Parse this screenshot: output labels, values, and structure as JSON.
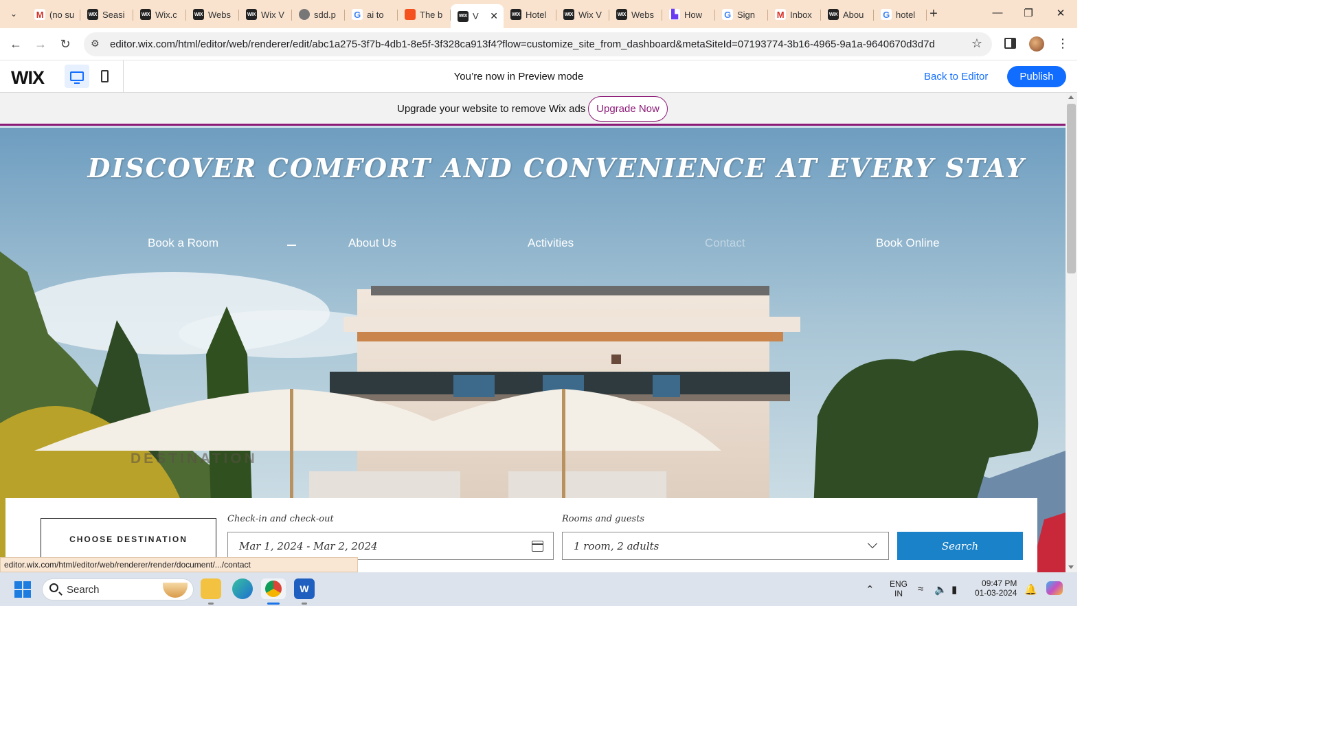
{
  "browser": {
    "tabs": [
      {
        "title": "(no su",
        "icon": "gmail-icon",
        "active": false
      },
      {
        "title": "Seasi",
        "icon": "wix-icon",
        "active": false
      },
      {
        "title": "Wix.c",
        "icon": "wix-icon",
        "active": false
      },
      {
        "title": "Webs",
        "icon": "wix-icon",
        "active": false
      },
      {
        "title": "Wix V",
        "icon": "wix-icon",
        "active": false
      },
      {
        "title": "sdd.p",
        "icon": "globe-icon",
        "active": false
      },
      {
        "title": "ai to",
        "icon": "google-icon",
        "active": false
      },
      {
        "title": "The b",
        "icon": "orange-square-icon",
        "active": false
      },
      {
        "title": "V",
        "icon": "wix-icon",
        "active": true
      },
      {
        "title": "Hotel",
        "icon": "wix-icon",
        "active": false
      },
      {
        "title": "Wix V",
        "icon": "wix-icon",
        "active": false
      },
      {
        "title": "Webs",
        "icon": "wix-icon",
        "active": false
      },
      {
        "title": "How",
        "icon": "purple-logo-icon",
        "active": false
      },
      {
        "title": "Sign",
        "icon": "google-icon",
        "active": false
      },
      {
        "title": "Inbox",
        "icon": "gmail-icon",
        "active": false
      },
      {
        "title": "Abou",
        "icon": "wix-icon",
        "active": false
      },
      {
        "title": "hotel",
        "icon": "google-icon",
        "active": false
      }
    ],
    "url": "editor.wix.com/html/editor/web/renderer/edit/abc1a275-3f7b-4db1-8e5f-3f328ca913f4?flow=customize_site_from_dashboard&metaSiteId=07193774-3b16-4965-9a1a-9640670d3d7d",
    "status_url": "editor.wix.com/html/editor/web/renderer/render/document/.../contact"
  },
  "wix_bar": {
    "logo": "WIX",
    "preview_message": "You’re now in Preview mode",
    "back_to_editor": "Back to Editor",
    "publish": "Publish"
  },
  "ad_banner": {
    "text": "Upgrade your website to remove Wix ads",
    "button": "Upgrade Now"
  },
  "hero": {
    "title": "DISCOVER COMFORT AND CONVENIENCE AT EVERY STAY",
    "nav": [
      "Book a Room",
      "About Us",
      "Activities",
      "Contact",
      "Book Online"
    ],
    "destination_label": "DESTINATION"
  },
  "booking": {
    "choose_destination": "CHOOSE DESTINATION",
    "checkin_label": "Check-in and check-out",
    "checkin_value": "Mar 1, 2024 - Mar 2, 2024",
    "rooms_label": "Rooms and guests",
    "rooms_value": "1 room, 2 adults",
    "search": "Search"
  },
  "taskbar": {
    "search": "Search",
    "lang_line1": "ENG",
    "lang_line2": "IN",
    "time": "09:47 PM",
    "date": "01-03-2024"
  },
  "colors": {
    "wix_blue": "#116dff",
    "upgrade_purple": "#8c1a77",
    "search_button": "#1a82c9",
    "tabstrip": "#f9e3cf"
  }
}
